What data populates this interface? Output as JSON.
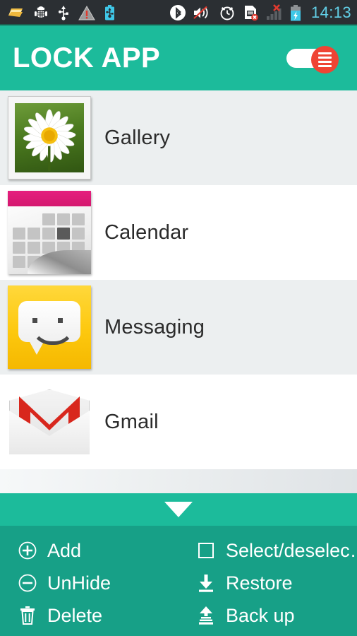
{
  "statusbar": {
    "time": "14:13",
    "left_icons": [
      {
        "name": "sdcard-icon"
      },
      {
        "name": "android-debug-bug-icon"
      },
      {
        "name": "usb-icon"
      },
      {
        "name": "warning-triangle-icon"
      },
      {
        "name": "usb-battery-icon"
      }
    ],
    "right_icons": [
      {
        "name": "bluetooth-icon"
      },
      {
        "name": "volume-mute-icon"
      },
      {
        "name": "alarm-clock-icon"
      },
      {
        "name": "sim-card-error-icon"
      },
      {
        "name": "signal-no-service-icon"
      },
      {
        "name": "battery-charging-icon"
      }
    ]
  },
  "appbar": {
    "title": "LOCK APP",
    "toggle": {
      "name": "list-menu-toggle",
      "state": "on",
      "knob_color": "#ef4434",
      "track_color": "#ffffff"
    }
  },
  "colors": {
    "accent_teal": "#1cbb9b",
    "panel_teal": "#17a087",
    "statusbar": "#2b2f33",
    "row_alt": "#eceff0",
    "clock_blue": "#62d0e8",
    "calendar_pink": "#e51f7e",
    "messaging_yellow": "#fdc80e",
    "gmail_red": "#d8271d"
  },
  "applist": [
    {
      "label": "Gallery",
      "icon": "gallery-photo-icon",
      "shade": "alt"
    },
    {
      "label": "Calendar",
      "icon": "calendar-icon",
      "shade": "plain"
    },
    {
      "label": "Messaging",
      "icon": "messaging-icon",
      "shade": "alt"
    },
    {
      "label": "Gmail",
      "icon": "gmail-icon",
      "shade": "plain"
    }
  ],
  "bottom": {
    "expander": {
      "name": "collapse-chevron",
      "glyph": "▼"
    },
    "menu_items": [
      {
        "label": "Add",
        "icon": "plus-circle-icon",
        "col": "left"
      },
      {
        "label": "Select/deselec…",
        "icon": "checkbox-icon",
        "col": "right"
      },
      {
        "label": "UnHide",
        "icon": "minus-circle-icon",
        "col": "left"
      },
      {
        "label": "Restore",
        "icon": "download-icon",
        "col": "right"
      },
      {
        "label": "Delete",
        "icon": "trash-icon",
        "col": "left"
      },
      {
        "label": "Back up",
        "icon": "upload-icon",
        "col": "right"
      }
    ]
  }
}
